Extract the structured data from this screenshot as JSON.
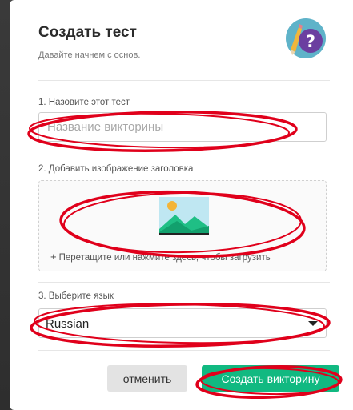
{
  "dialog": {
    "title": "Создать тест",
    "subtitle": "Давайте начнем с основ."
  },
  "name_section": {
    "label": "1. Назовите этот тест",
    "placeholder": "Название викторины",
    "value": ""
  },
  "image_section": {
    "label": "2. Добавить изображение заголовка",
    "hint": "Перетащите или нажмите здесь, чтобы загрузить",
    "plus": "+"
  },
  "language_section": {
    "label": "3. Выберите язык",
    "selected": "Russian"
  },
  "buttons": {
    "cancel": "отменить",
    "create": "Создать викторину"
  },
  "colors": {
    "accent": "#11b981",
    "annotation": "#e0001b"
  },
  "icons": {
    "logo": "pencil-question-icon",
    "upload": "image-placeholder-icon",
    "caret": "caret-down-icon"
  }
}
